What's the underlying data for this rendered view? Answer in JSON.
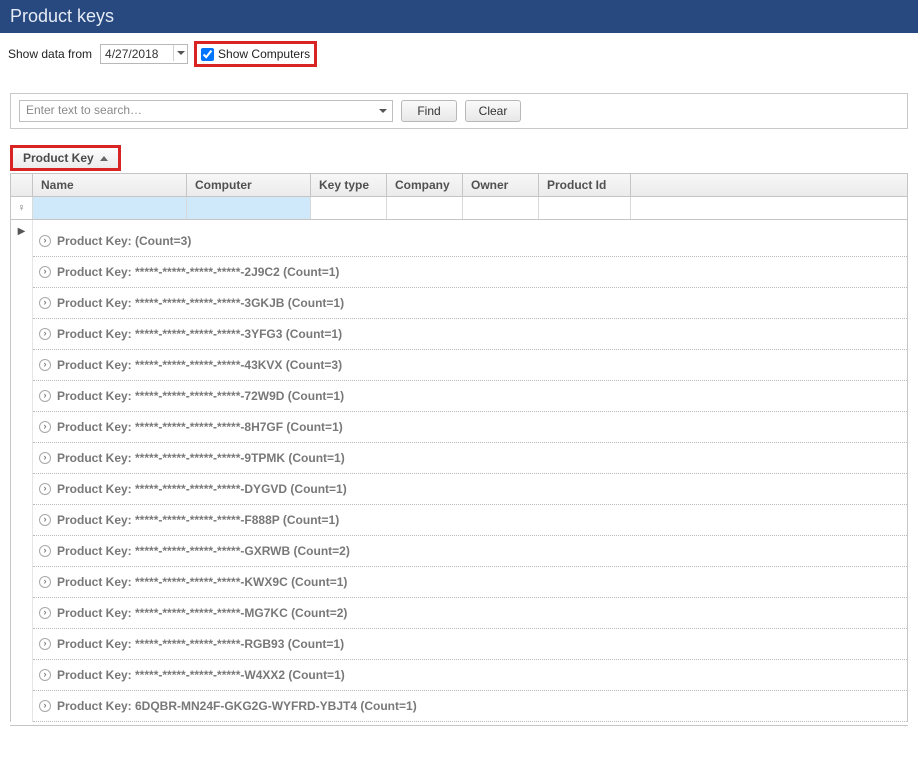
{
  "header": {
    "title": "Product keys"
  },
  "filter": {
    "show_data_label": "Show data from",
    "date_value": "4/27/2018",
    "show_computers_label": "Show Computers",
    "show_computers_checked": true
  },
  "search": {
    "placeholder": "Enter text to search…",
    "find_label": "Find",
    "clear_label": "Clear"
  },
  "group": {
    "chip_label": "Product Key"
  },
  "columns": {
    "name": "Name",
    "computer": "Computer",
    "keytype": "Key type",
    "company": "Company",
    "owner": "Owner",
    "productid": "Product Id"
  },
  "rows": [
    {
      "text": "Product Key:  (Count=3)"
    },
    {
      "text": "Product Key: *****-*****-*****-*****-2J9C2 (Count=1)"
    },
    {
      "text": "Product Key: *****-*****-*****-*****-3GKJB (Count=1)"
    },
    {
      "text": "Product Key: *****-*****-*****-*****-3YFG3 (Count=1)"
    },
    {
      "text": "Product Key: *****-*****-*****-*****-43KVX (Count=3)"
    },
    {
      "text": "Product Key: *****-*****-*****-*****-72W9D (Count=1)"
    },
    {
      "text": "Product Key: *****-*****-*****-*****-8H7GF (Count=1)"
    },
    {
      "text": "Product Key: *****-*****-*****-*****-9TPMK (Count=1)"
    },
    {
      "text": "Product Key: *****-*****-*****-*****-DYGVD (Count=1)"
    },
    {
      "text": "Product Key: *****-*****-*****-*****-F888P (Count=1)"
    },
    {
      "text": "Product Key: *****-*****-*****-*****-GXRWB (Count=2)"
    },
    {
      "text": "Product Key: *****-*****-*****-*****-KWX9C (Count=1)"
    },
    {
      "text": "Product Key: *****-*****-*****-*****-MG7KC (Count=2)"
    },
    {
      "text": "Product Key: *****-*****-*****-*****-RGB93 (Count=1)"
    },
    {
      "text": "Product Key: *****-*****-*****-*****-W4XX2 (Count=1)"
    },
    {
      "text": "Product Key: 6DQBR-MN24F-GKG2G-WYFRD-YBJT4 (Count=1)"
    }
  ]
}
